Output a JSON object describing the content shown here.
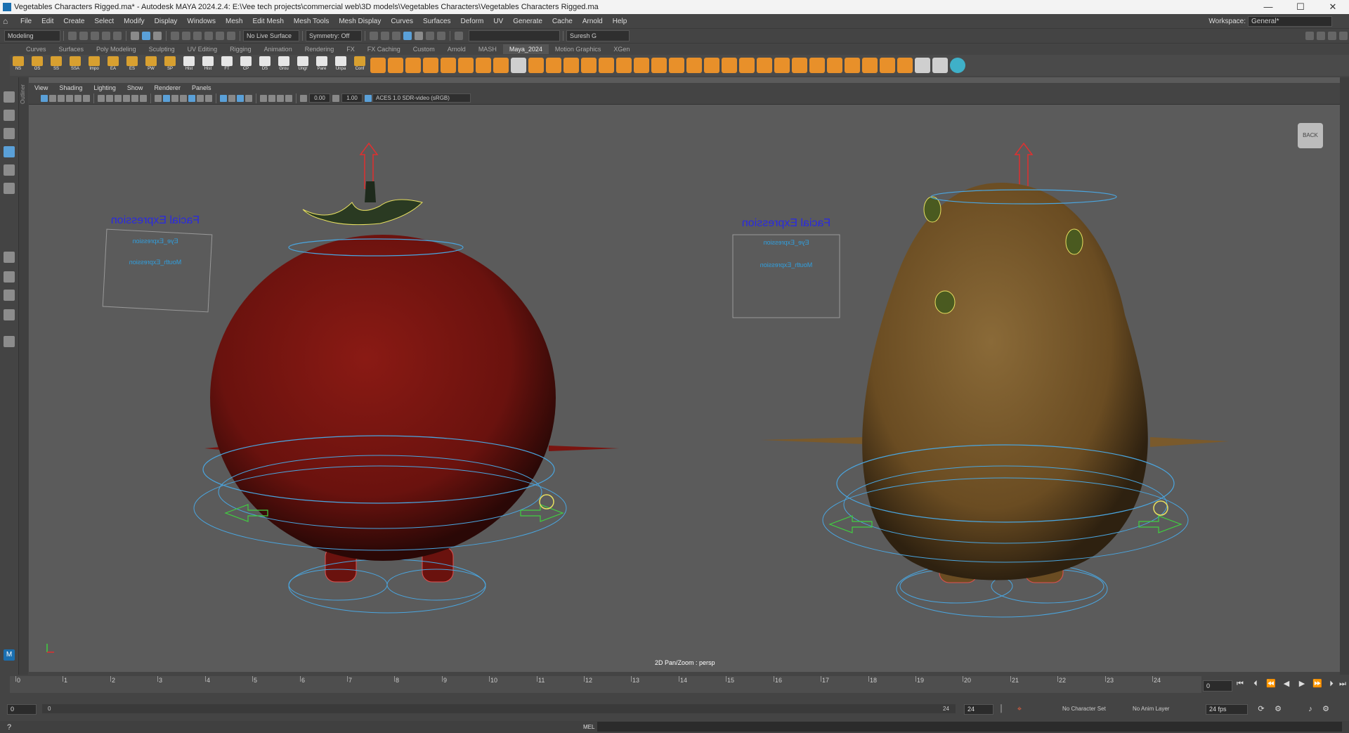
{
  "window": {
    "title": "Vegetables Characters Rigged.ma* - Autodesk MAYA 2024.2.4: E:\\Vee tech projects\\commercial web\\3D models\\Vegetables Characters\\Vegetables Characters Rigged.ma",
    "controls": [
      "—",
      "☐",
      "✕"
    ]
  },
  "menubar": {
    "items": [
      "File",
      "Edit",
      "Create",
      "Select",
      "Modify",
      "Display",
      "Windows",
      "Mesh",
      "Edit Mesh",
      "Mesh Tools",
      "Mesh Display",
      "Curves",
      "Surfaces",
      "Deform",
      "UV",
      "Generate",
      "Cache",
      "Arnold",
      "Help"
    ],
    "workspace_label": "Workspace:",
    "workspace_value": "General*"
  },
  "statusline": {
    "mode": "Modeling",
    "live_surface": "No Live Surface",
    "symmetry": "Symmetry: Off",
    "user": "Suresh G"
  },
  "shelf": {
    "tabs": [
      "Curves",
      "Surfaces",
      "Poly Modeling",
      "Sculpting",
      "UV Editing",
      "Rigging",
      "Animation",
      "Rendering",
      "FX",
      "FX Caching",
      "Custom",
      "Arnold",
      "MASH",
      "Maya_2024",
      "Motion Graphics",
      "XGen"
    ],
    "active_tab": "Maya_2024",
    "labeled_buttons": [
      "NS",
      "OS",
      "SS",
      "SSA",
      "Impo",
      "EA",
      "ES",
      "PW",
      "SP",
      "Hist",
      "Hist",
      "FT",
      "CP",
      "DS",
      "Grou",
      "Ungr",
      "Pare",
      "Unpa",
      "Conf"
    ]
  },
  "toolbox": {
    "outliner_label": "Outliner",
    "maya_logo_text": "M"
  },
  "viewport": {
    "menu": [
      "View",
      "Shading",
      "Lighting",
      "Show",
      "Renderer",
      "Panels"
    ],
    "exposure": "0.00",
    "gamma": "1.00",
    "color_space": "ACES 1.0 SDR-video (sRGB)",
    "camera_label": "2D Pan/Zoom : persp",
    "view_cube": "BACK",
    "facial_panel_title": "Facial Expression",
    "eye_label": "Eye_Expression",
    "mouth_label": "Mouth_Expression"
  },
  "timeslider": {
    "ticks": [
      "0",
      "1",
      "2",
      "3",
      "4",
      "5",
      "6",
      "7",
      "8",
      "9",
      "10",
      "11",
      "12",
      "13",
      "14",
      "15",
      "16",
      "17",
      "18",
      "19",
      "20",
      "21",
      "22",
      "23",
      "24"
    ],
    "current_frame": "0",
    "start_marker": "0"
  },
  "rangeslider": {
    "start": "0",
    "inner_start": "0",
    "inner_end": "24",
    "end": "24",
    "character_set": "No Character Set",
    "anim_layer": "No Anim Layer",
    "fps": "24 fps"
  },
  "cmdline": {
    "label": "MEL"
  },
  "colors": {
    "tomato": "#7a1410",
    "potato": "#7a5a2c",
    "rig_blue": "#4aa6e0",
    "rig_yellow": "#e8e060",
    "rig_green": "#40d040"
  }
}
